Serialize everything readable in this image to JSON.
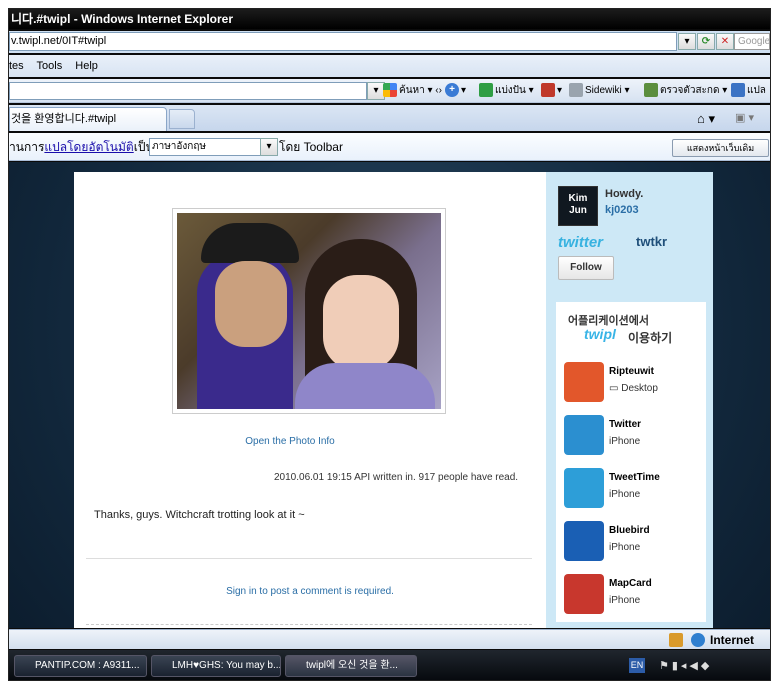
{
  "window": {
    "title": "니다.#twipl - Windows Internet Explorer"
  },
  "address": {
    "url": "v.twipl.net/0IT#twipl",
    "search_placeholder": "Google"
  },
  "menu": {
    "items": [
      "tes",
      "Tools",
      "Help"
    ]
  },
  "toolbar": {
    "search_label": "ค้นหา",
    "share_label": "แบ่งปัน",
    "sidewiki_label": "Sidewiki",
    "spell_label": "ตรวจตัวสะกด",
    "translate_label": "แปล"
  },
  "tabs": {
    "active_label": "것을 환영합니다.#twipl"
  },
  "translate_bar": {
    "prefix": "่านการ",
    "link": "แปลโดยอัตโนมัติ",
    "suffix": "เป็น",
    "language": "ภาษาอังกฤษ",
    "by": "โดย Toolbar",
    "show_original": "แสดงหน้าเว็บเดิม"
  },
  "post": {
    "photo_link": "Open the Photo Info",
    "meta": "2010.06.01 19:15 API written in. 917 people have read.",
    "text": "Thanks, guys. Witchcraft trotting look at it ~",
    "comment_prompt": "Sign in to post a comment is required."
  },
  "profile": {
    "avatar_text": "Kim Jun",
    "greeting": "Howdy.",
    "username": "kj0203",
    "twitter_label": "twitter",
    "twtkr_label": "twtkr",
    "follow_label": "Follow"
  },
  "apps": {
    "header_line1": "어플리케이션에서",
    "header_brand": "twipl",
    "header_line2": "이용하기",
    "items": [
      {
        "name": "Ripteuwit",
        "platform": "Desktop",
        "color": "#e2572b"
      },
      {
        "name": "Twitter",
        "platform": "iPhone",
        "color": "#2b8fd0"
      },
      {
        "name": "TweetTime",
        "platform": "iPhone",
        "color": "#2d9ed8"
      },
      {
        "name": "Bluebird",
        "platform": "iPhone",
        "color": "#1a5fb4"
      },
      {
        "name": "MapCard",
        "platform": "iPhone",
        "color": "#c8372d"
      }
    ]
  },
  "statusbar": {
    "zone": "Internet"
  },
  "taskbar": {
    "tasks": [
      "PANTIP.COM : A9311...",
      "LMH♥GHS: You may b...",
      "twipl에 오신 것을 환..."
    ],
    "lang": "EN"
  }
}
